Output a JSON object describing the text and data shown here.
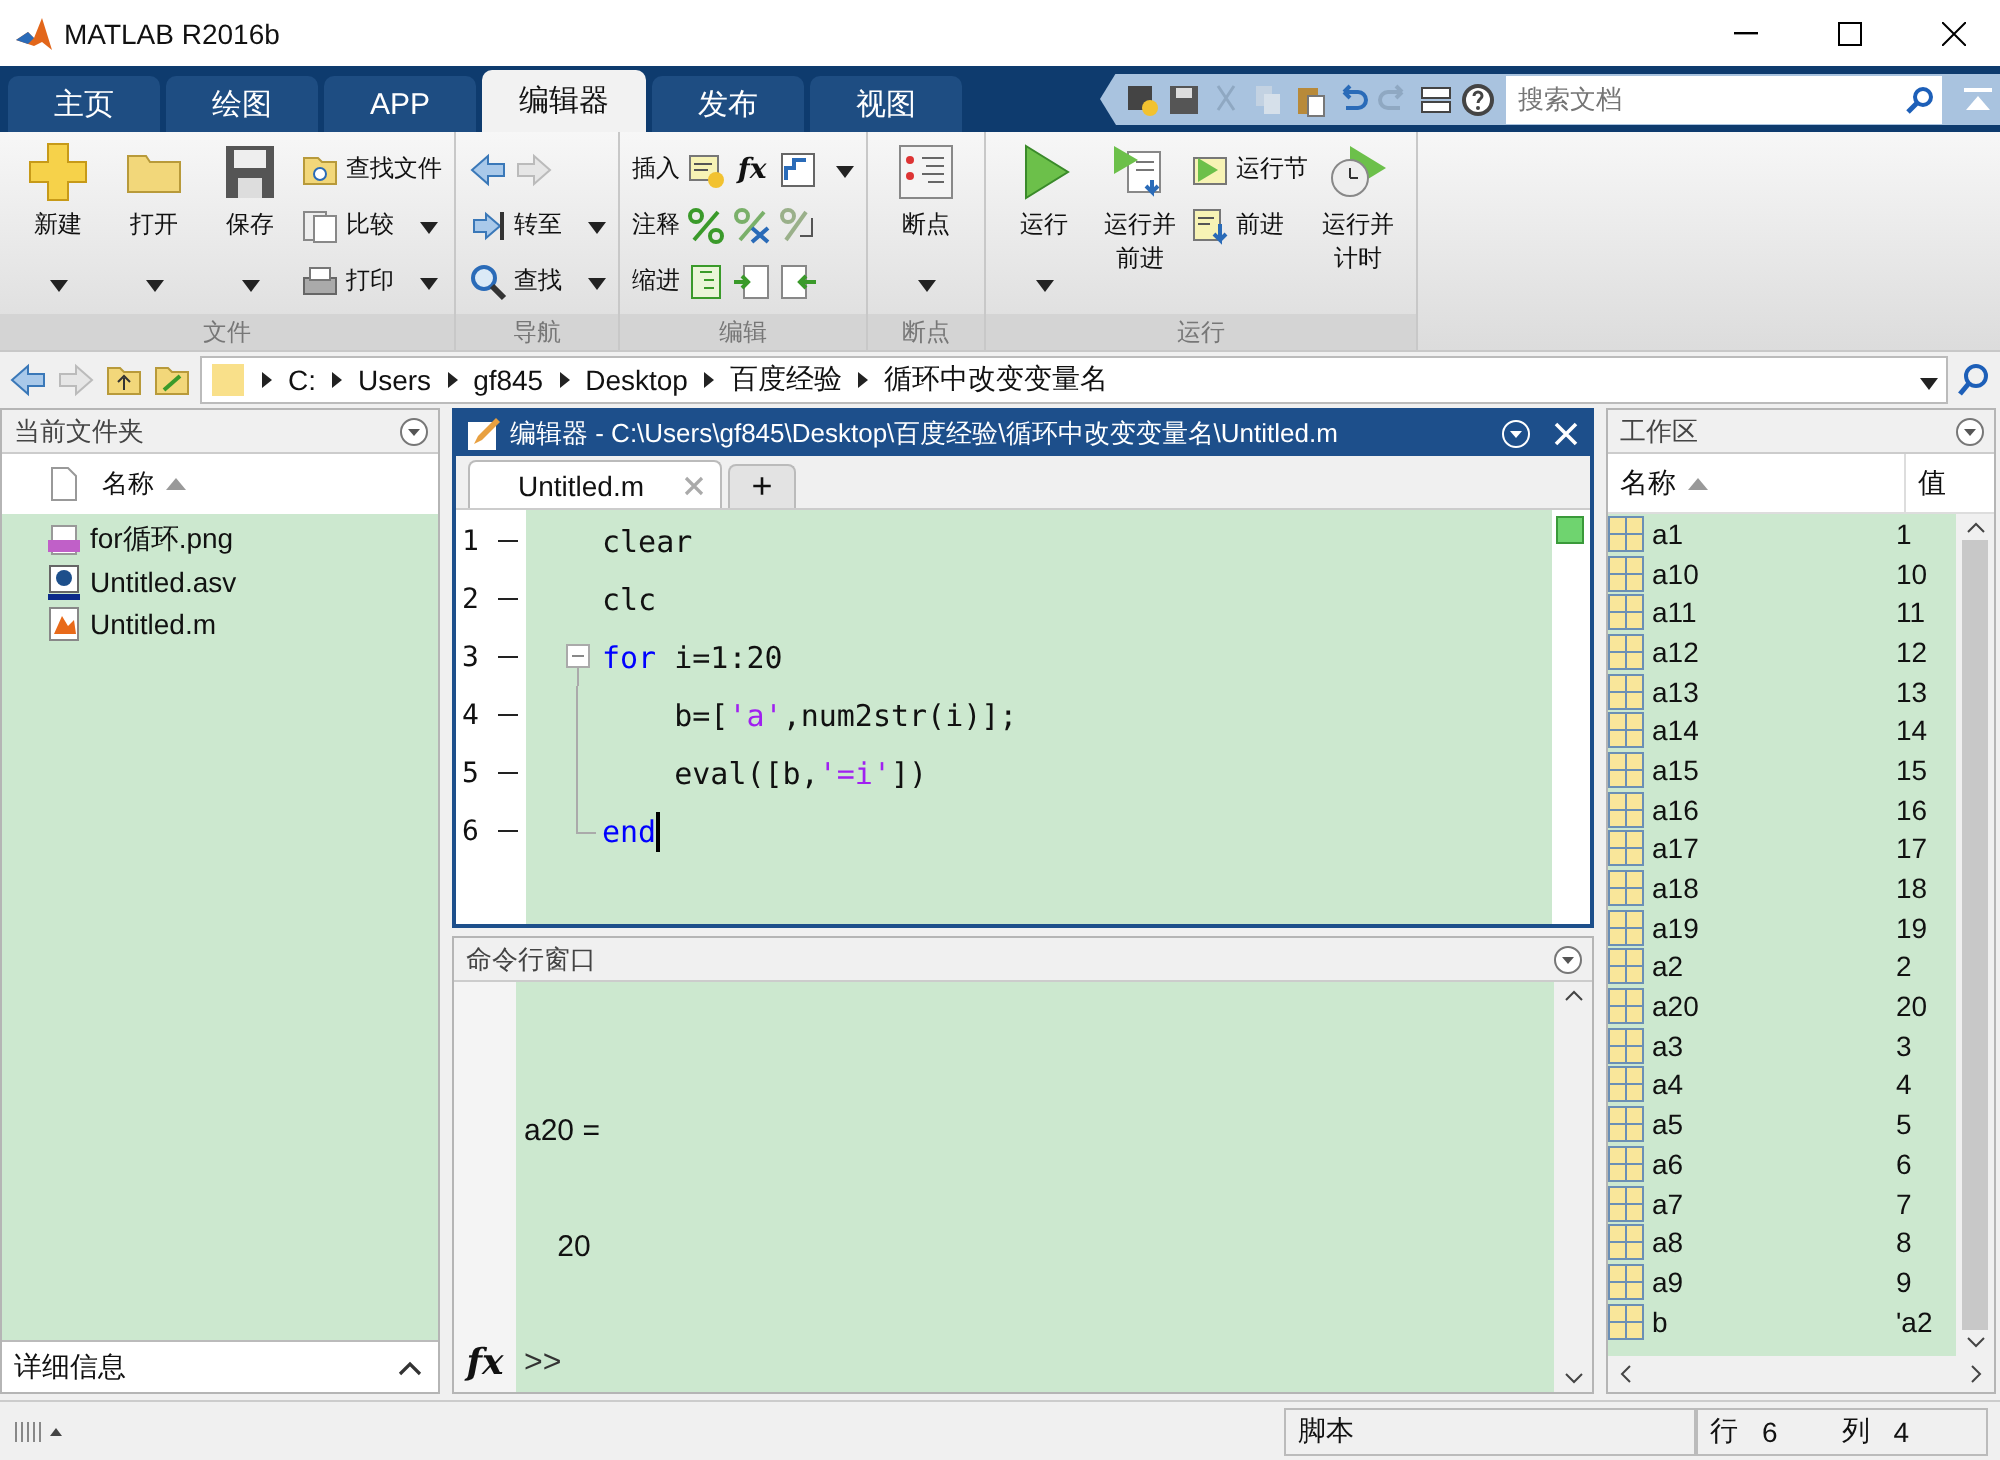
{
  "window": {
    "title": "MATLAB R2016b"
  },
  "tabs": [
    {
      "label": "主页",
      "selected": false
    },
    {
      "label": "绘图",
      "selected": false
    },
    {
      "label": "APP",
      "selected": false
    },
    {
      "label": "编辑器",
      "selected": true
    },
    {
      "label": "发布",
      "selected": false
    },
    {
      "label": "视图",
      "selected": false
    }
  ],
  "search": {
    "placeholder": "搜索文档"
  },
  "ribbon": {
    "groups": [
      {
        "label": "文件",
        "columns": [
          {
            "kind": "large",
            "label": "新建",
            "dropdown": true
          },
          {
            "kind": "large",
            "label": "打开",
            "dropdown": true
          },
          {
            "kind": "large",
            "label": "保存",
            "dropdown": true
          },
          {
            "kind": "stack",
            "rows": [
              {
                "label": "查找文件",
                "dropdown": false
              },
              {
                "label": "比较",
                "dropdown": true
              },
              {
                "label": "打印",
                "dropdown": true
              }
            ]
          }
        ]
      },
      {
        "label": "导航",
        "columns": [
          {
            "kind": "stack",
            "rows": [
              {},
              {
                "label": "转至",
                "dropdown": true
              },
              {
                "label": "查找",
                "dropdown": true
              }
            ]
          }
        ]
      },
      {
        "label": "编辑",
        "columns": [
          {
            "kind": "stack",
            "rows": [
              {
                "label": "插入",
                "dropdown": true,
                "icon_text": "fx"
              },
              {
                "label": "注释",
                "dropdown": false
              },
              {
                "label": "缩进",
                "dropdown": false
              }
            ]
          }
        ]
      },
      {
        "label": "断点",
        "columns": [
          {
            "kind": "large",
            "label": "断点",
            "dropdown": true
          }
        ]
      },
      {
        "label": "运行",
        "columns": [
          {
            "kind": "large",
            "label": "运行",
            "dropdown": true
          },
          {
            "kind": "large",
            "label": "运行并前进",
            "dropdown": false
          },
          {
            "kind": "stack",
            "rows": [
              {
                "label": "运行节",
                "dropdown": false
              },
              {
                "label": "前进",
                "dropdown": false
              }
            ]
          },
          {
            "kind": "large",
            "label": "运行并计时",
            "dropdown": false
          }
        ]
      }
    ]
  },
  "path": [
    "C:",
    "Users",
    "gf845",
    "Desktop",
    "百度经验",
    "循环中改变变量名"
  ],
  "current_folder": {
    "title": "当前文件夹",
    "column": "名称",
    "files": [
      {
        "name": "for循环.png",
        "kind": "png"
      },
      {
        "name": "Untitled.asv",
        "kind": "asv"
      },
      {
        "name": "Untitled.m",
        "kind": "m"
      }
    ],
    "details": "详细信息"
  },
  "editor": {
    "title": "编辑器 - C:\\Users\\gf845\\Desktop\\百度经验\\循环中改变变量名\\Untitled.m",
    "tabs": [
      {
        "label": "Untitled.m",
        "selected": true
      }
    ],
    "new_tab": "+",
    "lines": [
      {
        "number": "1",
        "kind": "plain",
        "tokens": [
          {
            "kind": "plain",
            "text": "clear"
          }
        ]
      },
      {
        "number": "2",
        "kind": "plain",
        "tokens": [
          {
            "kind": "plain",
            "text": "clc"
          }
        ]
      },
      {
        "number": "3",
        "kind": "foldstart",
        "tokens": [
          {
            "kind": "keyword",
            "text": "for"
          },
          {
            "kind": "plain",
            "text": " i=1:20"
          }
        ]
      },
      {
        "number": "4",
        "kind": "foldbody",
        "tokens": [
          {
            "kind": "plain",
            "text": "    b=["
          },
          {
            "kind": "string",
            "text": "'a'"
          },
          {
            "kind": "plain",
            "text": ",num2str(i)];"
          }
        ]
      },
      {
        "number": "5",
        "kind": "foldbody",
        "tokens": [
          {
            "kind": "plain",
            "text": "    eval([b,"
          },
          {
            "kind": "string",
            "text": "'=i'"
          },
          {
            "kind": "plain",
            "text": "])"
          }
        ]
      },
      {
        "number": "6",
        "kind": "foldend",
        "cursor": true,
        "tokens": [
          {
            "kind": "keyword",
            "text": "end"
          }
        ]
      }
    ]
  },
  "command_window": {
    "title": "命令行窗口",
    "output": [
      "a20 =",
      "    20"
    ],
    "fx": "fx",
    "prompt": ">>"
  },
  "workspace": {
    "title": "工作区",
    "columns": [
      "名称",
      "值"
    ],
    "variables": [
      {
        "name": "a1",
        "value": "1"
      },
      {
        "name": "a10",
        "value": "10"
      },
      {
        "name": "a11",
        "value": "11"
      },
      {
        "name": "a12",
        "value": "12"
      },
      {
        "name": "a13",
        "value": "13"
      },
      {
        "name": "a14",
        "value": "14"
      },
      {
        "name": "a15",
        "value": "15"
      },
      {
        "name": "a16",
        "value": "16"
      },
      {
        "name": "a17",
        "value": "17"
      },
      {
        "name": "a18",
        "value": "18"
      },
      {
        "name": "a19",
        "value": "19"
      },
      {
        "name": "a2",
        "value": "2"
      },
      {
        "name": "a20",
        "value": "20"
      },
      {
        "name": "a3",
        "value": "3"
      },
      {
        "name": "a4",
        "value": "4"
      },
      {
        "name": "a5",
        "value": "5"
      },
      {
        "name": "a6",
        "value": "6"
      },
      {
        "name": "a7",
        "value": "7"
      },
      {
        "name": "a8",
        "value": "8"
      },
      {
        "name": "a9",
        "value": "9"
      },
      {
        "name": "b",
        "value": "'a2"
      }
    ]
  },
  "status_bar": {
    "file_type": "脚本",
    "row_label": "行",
    "row": "6",
    "col_label": "列",
    "col": "4"
  }
}
